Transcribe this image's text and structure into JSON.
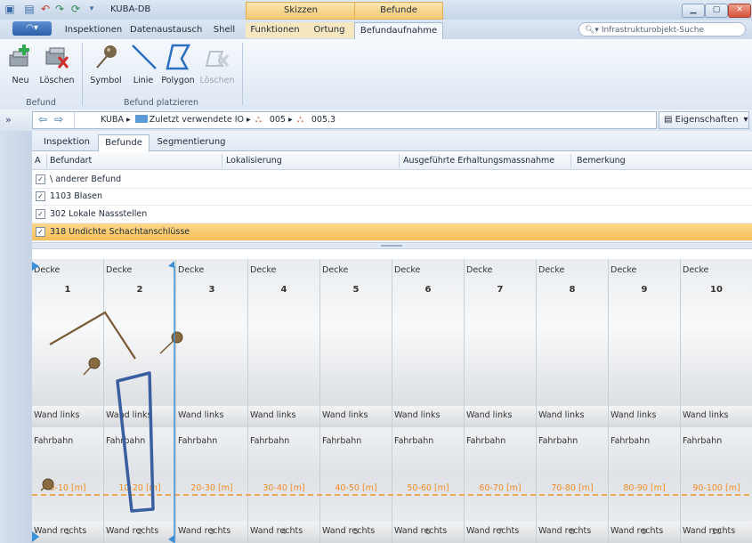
{
  "window": {
    "title": "KUBA-DB"
  },
  "context_tabs": {
    "skizzen": "Skizzen",
    "befunde": "Befunde"
  },
  "ribbon_tabs": [
    "Inspektionen",
    "Datenaustausch",
    "Shell",
    "Funktionen",
    "Ortung",
    "Befundaufnahme"
  ],
  "search": {
    "placeholder": "Infrastrukturobjekt-Suche"
  },
  "ribbon": {
    "group_befund": {
      "label": "Befund",
      "new_label": "Neu",
      "delete_label": "Löschen"
    },
    "group_place": {
      "label": "Befund platzieren",
      "symbol_label": "Symbol",
      "line_label": "Linie",
      "polygon_label": "Polygon",
      "delete_label": "Löschen"
    }
  },
  "breadcrumb": {
    "items": [
      "KUBA",
      "Zuletzt verwendete IO",
      "005",
      "005.3"
    ]
  },
  "properties_button": "Eigenschaften",
  "subtabs": [
    "Inspektion",
    "Befunde",
    "Segmentierung"
  ],
  "table": {
    "headers": [
      "A",
      "Befundart",
      "Lokalisierung",
      "Ausgeführte Erhaltungsmassnahme",
      "Bemerkung"
    ],
    "rows": [
      {
        "checked": true,
        "befundart": "\\ anderer Befund"
      },
      {
        "checked": true,
        "befundart": "1103 Blasen"
      },
      {
        "checked": true,
        "befundart": "302 Lokale Nassstellen"
      },
      {
        "checked": true,
        "befundart": "318 Undichte Schachtanschlüsse",
        "selected": true
      }
    ]
  },
  "schematic": {
    "columns": [
      {
        "top": "Decke",
        "num": "1",
        "wl": "Wand links",
        "fb": "Fahrbahn",
        "range": "0-10 [m]",
        "wr": "Wand rechts",
        "bnum": "1"
      },
      {
        "top": "Decke",
        "num": "2",
        "wl": "Wand links",
        "fb": "Fahrbahn",
        "range": "10-20 [m]",
        "wr": "Wand rechts",
        "bnum": "2"
      },
      {
        "top": "Decke",
        "num": "3",
        "wl": "Wand links",
        "fb": "Fahrbahn",
        "range": "20-30 [m]",
        "wr": "Wand rechts",
        "bnum": "3"
      },
      {
        "top": "Decke",
        "num": "4",
        "wl": "Wand links",
        "fb": "Fahrbahn",
        "range": "30-40 [m]",
        "wr": "Wand rechts",
        "bnum": "4"
      },
      {
        "top": "Decke",
        "num": "5",
        "wl": "Wand links",
        "fb": "Fahrbahn",
        "range": "40-50 [m]",
        "wr": "Wand rechts",
        "bnum": "5"
      },
      {
        "top": "Decke",
        "num": "6",
        "wl": "Wand links",
        "fb": "Fahrbahn",
        "range": "50-60 [m]",
        "wr": "Wand rechts",
        "bnum": "6"
      },
      {
        "top": "Decke",
        "num": "7",
        "wl": "Wand links",
        "fb": "Fahrbahn",
        "range": "60-70 [m]",
        "wr": "Wand rechts",
        "bnum": "7"
      },
      {
        "top": "Decke",
        "num": "8",
        "wl": "Wand links",
        "fb": "Fahrbahn",
        "range": "70-80 [m]",
        "wr": "Wand rechts",
        "bnum": "8"
      },
      {
        "top": "Decke",
        "num": "9",
        "wl": "Wand links",
        "fb": "Fahrbahn",
        "range": "80-90 [m]",
        "wr": "Wand rechts",
        "bnum": "9"
      },
      {
        "top": "Decke",
        "num": "10",
        "wl": "Wand links",
        "fb": "Fahrbahn",
        "range": "90-100 [m]",
        "wr": "Wand rechts",
        "bnum": "10"
      }
    ]
  },
  "colors": {
    "accent": "#f6bf57",
    "line": "#7a5a32",
    "polygon": "#3a5fa0",
    "marker": "#3b8fd6",
    "range_text": "#f08c28"
  }
}
